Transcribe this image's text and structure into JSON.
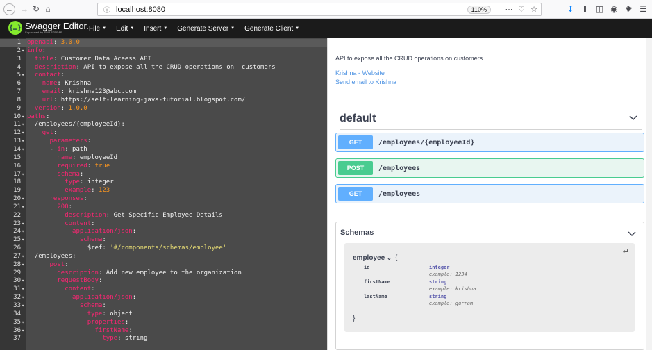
{
  "browser": {
    "url": "localhost:8080",
    "zoom": "110%"
  },
  "topbar": {
    "logo_title": "Swagger Editor.",
    "logo_sub": "Supported by SMARTBEAR",
    "menu": [
      {
        "label": "File"
      },
      {
        "label": "Edit"
      },
      {
        "label": "Insert"
      },
      {
        "label": "Generate Server"
      },
      {
        "label": "Generate Client"
      }
    ]
  },
  "editor": {
    "active_line": 1,
    "lines": [
      {
        "n": "1",
        "fold": "",
        "tokens": [
          [
            "k",
            "openapi"
          ],
          [
            "plain",
            ": "
          ],
          [
            "n",
            "3.0.0"
          ]
        ]
      },
      {
        "n": "2",
        "fold": "▾",
        "tokens": [
          [
            "k",
            "info"
          ],
          [
            "plain",
            ":"
          ]
        ]
      },
      {
        "n": "3",
        "fold": "",
        "tokens": [
          [
            "plain",
            "  "
          ],
          [
            "k",
            "title"
          ],
          [
            "plain",
            ": Customer Data Aceess API"
          ]
        ]
      },
      {
        "n": "4",
        "fold": "",
        "tokens": [
          [
            "plain",
            "  "
          ],
          [
            "k",
            "description"
          ],
          [
            "plain",
            ": API to expose all the CRUD operations on  customers"
          ]
        ]
      },
      {
        "n": "5",
        "fold": "▾",
        "tokens": [
          [
            "plain",
            "  "
          ],
          [
            "k",
            "contact"
          ],
          [
            "plain",
            ":"
          ]
        ]
      },
      {
        "n": "6",
        "fold": "",
        "tokens": [
          [
            "plain",
            "    "
          ],
          [
            "k",
            "name"
          ],
          [
            "plain",
            ": Krishna"
          ]
        ]
      },
      {
        "n": "7",
        "fold": "",
        "tokens": [
          [
            "plain",
            "    "
          ],
          [
            "k",
            "email"
          ],
          [
            "plain",
            ": krishna123@abc.com"
          ]
        ]
      },
      {
        "n": "8",
        "fold": "",
        "tokens": [
          [
            "plain",
            "    "
          ],
          [
            "k",
            "url"
          ],
          [
            "plain",
            ": https://self-learning-java-tutorial.blogspot.com/"
          ]
        ]
      },
      {
        "n": "9",
        "fold": "",
        "tokens": [
          [
            "plain",
            "  "
          ],
          [
            "k",
            "version"
          ],
          [
            "plain",
            ": "
          ],
          [
            "n",
            "1.0.0"
          ]
        ]
      },
      {
        "n": "10",
        "fold": "▾",
        "tokens": [
          [
            "k",
            "paths"
          ],
          [
            "plain",
            ":"
          ]
        ]
      },
      {
        "n": "11",
        "fold": "▾",
        "tokens": [
          [
            "plain",
            "  /employees/{employeeId}:"
          ]
        ]
      },
      {
        "n": "12",
        "fold": "▾",
        "tokens": [
          [
            "plain",
            "    "
          ],
          [
            "k",
            "get"
          ],
          [
            "plain",
            ":"
          ]
        ]
      },
      {
        "n": "13",
        "fold": "▾",
        "tokens": [
          [
            "plain",
            "      "
          ],
          [
            "k",
            "parameters"
          ],
          [
            "plain",
            ":"
          ]
        ]
      },
      {
        "n": "14",
        "fold": "▾",
        "tokens": [
          [
            "plain",
            "      - "
          ],
          [
            "k",
            "in"
          ],
          [
            "plain",
            ": path"
          ]
        ]
      },
      {
        "n": "15",
        "fold": "",
        "tokens": [
          [
            "plain",
            "        "
          ],
          [
            "k",
            "name"
          ],
          [
            "plain",
            ": employeeId"
          ]
        ]
      },
      {
        "n": "16",
        "fold": "",
        "tokens": [
          [
            "plain",
            "        "
          ],
          [
            "k",
            "required"
          ],
          [
            "plain",
            ": "
          ],
          [
            "n",
            "true"
          ]
        ]
      },
      {
        "n": "17",
        "fold": "▾",
        "tokens": [
          [
            "plain",
            "        "
          ],
          [
            "k",
            "schema"
          ],
          [
            "plain",
            ":"
          ]
        ]
      },
      {
        "n": "18",
        "fold": "",
        "tokens": [
          [
            "plain",
            "          "
          ],
          [
            "k",
            "type"
          ],
          [
            "plain",
            ": integer"
          ]
        ]
      },
      {
        "n": "19",
        "fold": "",
        "tokens": [
          [
            "plain",
            "          "
          ],
          [
            "k",
            "example"
          ],
          [
            "plain",
            ": "
          ],
          [
            "n",
            "123"
          ]
        ]
      },
      {
        "n": "20",
        "fold": "▾",
        "tokens": [
          [
            "plain",
            "      "
          ],
          [
            "k",
            "responses"
          ],
          [
            "plain",
            ":"
          ]
        ]
      },
      {
        "n": "21",
        "fold": "▾",
        "tokens": [
          [
            "plain",
            "        "
          ],
          [
            "k",
            "200"
          ],
          [
            "plain",
            ":"
          ]
        ]
      },
      {
        "n": "22",
        "fold": "",
        "tokens": [
          [
            "plain",
            "          "
          ],
          [
            "k",
            "description"
          ],
          [
            "plain",
            ": Get Specific Employee Details"
          ]
        ]
      },
      {
        "n": "23",
        "fold": "▾",
        "tokens": [
          [
            "plain",
            "          "
          ],
          [
            "k",
            "content"
          ],
          [
            "plain",
            ":"
          ]
        ]
      },
      {
        "n": "24",
        "fold": "▾",
        "tokens": [
          [
            "plain",
            "            "
          ],
          [
            "k",
            "application/json"
          ],
          [
            "plain",
            ":"
          ]
        ]
      },
      {
        "n": "25",
        "fold": "▾",
        "tokens": [
          [
            "plain",
            "              "
          ],
          [
            "k",
            "schema"
          ],
          [
            "plain",
            ":"
          ]
        ]
      },
      {
        "n": "26",
        "fold": "",
        "tokens": [
          [
            "plain",
            "                $ref: "
          ],
          [
            "s",
            "'#/components/schemas/employee'"
          ]
        ]
      },
      {
        "n": "27",
        "fold": "▾",
        "tokens": [
          [
            "plain",
            "  /employees:"
          ]
        ]
      },
      {
        "n": "28",
        "fold": "▾",
        "tokens": [
          [
            "plain",
            "      "
          ],
          [
            "k",
            "post"
          ],
          [
            "plain",
            ":"
          ]
        ]
      },
      {
        "n": "29",
        "fold": "",
        "tokens": [
          [
            "plain",
            "        "
          ],
          [
            "k",
            "description"
          ],
          [
            "plain",
            ": Add new employee to the organization"
          ]
        ]
      },
      {
        "n": "30",
        "fold": "▾",
        "tokens": [
          [
            "plain",
            "        "
          ],
          [
            "k",
            "requestBody"
          ],
          [
            "plain",
            ":"
          ]
        ]
      },
      {
        "n": "31",
        "fold": "▾",
        "tokens": [
          [
            "plain",
            "          "
          ],
          [
            "k",
            "content"
          ],
          [
            "plain",
            ":"
          ]
        ]
      },
      {
        "n": "32",
        "fold": "▾",
        "tokens": [
          [
            "plain",
            "            "
          ],
          [
            "k",
            "application/json"
          ],
          [
            "plain",
            ":"
          ]
        ]
      },
      {
        "n": "33",
        "fold": "▾",
        "tokens": [
          [
            "plain",
            "              "
          ],
          [
            "k",
            "schema"
          ],
          [
            "plain",
            ":"
          ]
        ]
      },
      {
        "n": "34",
        "fold": "",
        "tokens": [
          [
            "plain",
            "                "
          ],
          [
            "k",
            "type"
          ],
          [
            "plain",
            ": object"
          ]
        ]
      },
      {
        "n": "35",
        "fold": "▾",
        "tokens": [
          [
            "plain",
            "                "
          ],
          [
            "k",
            "properties"
          ],
          [
            "plain",
            ":"
          ]
        ]
      },
      {
        "n": "36",
        "fold": "▾",
        "tokens": [
          [
            "plain",
            "                  "
          ],
          [
            "k",
            "firstName"
          ],
          [
            "plain",
            ":"
          ]
        ]
      },
      {
        "n": "37",
        "fold": "",
        "tokens": [
          [
            "plain",
            "                    "
          ],
          [
            "k",
            "type"
          ],
          [
            "plain",
            ": string"
          ]
        ]
      }
    ]
  },
  "preview": {
    "description": "API to expose all the CRUD operations on customers",
    "link_website": "Krishna - Website",
    "link_email": "Send email to Krishna",
    "section_title": "default",
    "operations": [
      {
        "method": "GET",
        "path": "/employees/{employeeId}",
        "kind": "get"
      },
      {
        "method": "POST",
        "path": "/employees",
        "kind": "post"
      },
      {
        "method": "GET",
        "path": "/employees",
        "kind": "get"
      }
    ],
    "schemas_title": "Schemas",
    "model": {
      "name": "employee",
      "open_brace": "{",
      "close_brace": "}",
      "props": [
        {
          "name": "id",
          "type": "integer",
          "example": "example: 1234"
        },
        {
          "name": "firstName",
          "type": "string",
          "example": "example: krishna"
        },
        {
          "name": "lastName",
          "type": "string",
          "example": "example: gurram"
        }
      ]
    }
  },
  "colors": {
    "get": "#61affe",
    "post": "#49cc90",
    "editor_bg": "#4a4a4a",
    "topbar_bg": "#1b1b1b"
  }
}
